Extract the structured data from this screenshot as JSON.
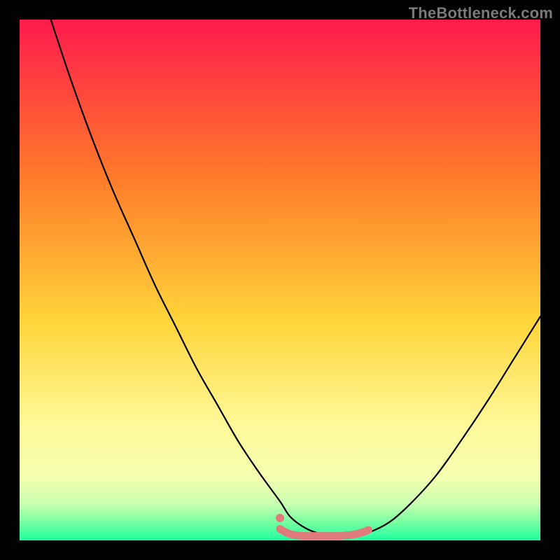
{
  "watermark": "TheBottleneck.com",
  "colors": {
    "gradient_top": "#ff1a4d",
    "gradient_mid1": "#ff7a2a",
    "gradient_mid2": "#ffd53a",
    "gradient_mid3": "#fff99a",
    "gradient_bottom_band1": "#f4ffb0",
    "gradient_bottom_band2": "#c9ffb0",
    "gradient_bottom_band3": "#6affa0",
    "gradient_bottom": "#1effa0",
    "curve": "#000000",
    "marker": "#e17b7b",
    "marker_dot": "#e17b7b",
    "frame": "#000000"
  },
  "chart_data": {
    "type": "line",
    "title": "",
    "xlabel": "",
    "ylabel": "",
    "xlim": [
      0,
      100
    ],
    "ylim": [
      0,
      100
    ],
    "legend": false,
    "grid": false,
    "series": [
      {
        "name": "bottleneck-curve",
        "x": [
          6,
          10,
          14,
          18,
          22,
          26,
          30,
          34,
          38,
          42,
          46,
          50,
          52,
          55,
          58,
          61,
          64,
          67,
          71,
          75,
          80,
          85,
          90,
          95,
          100
        ],
        "y": [
          100,
          88,
          77,
          67,
          58,
          49,
          41,
          33,
          26,
          19,
          13,
          7.5,
          4.5,
          2.3,
          1.2,
          0.8,
          0.8,
          1.5,
          3.5,
          7,
          12.5,
          19.5,
          27,
          35,
          43
        ]
      },
      {
        "name": "optimal-range-marker",
        "x": [
          50,
          51,
          52,
          53,
          54,
          55,
          56,
          57,
          58,
          59,
          60,
          61,
          62,
          63,
          64,
          65,
          66,
          67
        ],
        "y": [
          2.2,
          1.6,
          1.2,
          1.0,
          0.9,
          0.85,
          0.85,
          0.85,
          0.85,
          0.85,
          0.85,
          0.85,
          0.9,
          1.0,
          1.1,
          1.3,
          1.6,
          2.0
        ]
      }
    ],
    "annotations": [
      {
        "type": "dot",
        "x": 50,
        "y": 4.3,
        "series": "optimal-range-marker"
      }
    ]
  }
}
